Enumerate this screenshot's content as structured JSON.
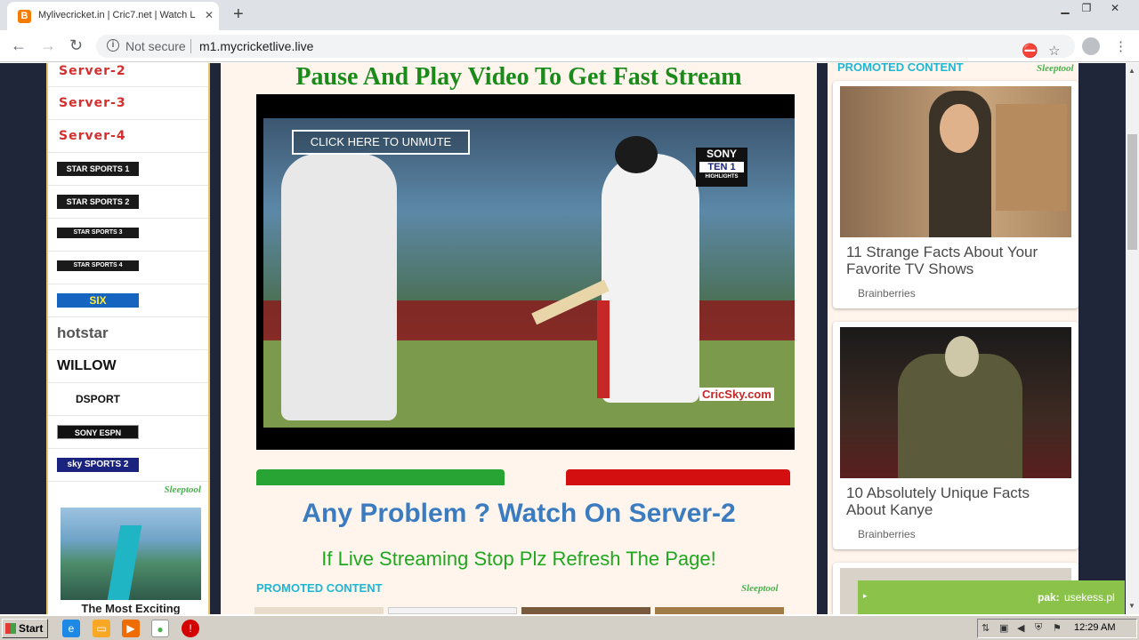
{
  "browser": {
    "tab_title": "Mylivecricket.in | Cric7.net | Watch L",
    "tab_favicon": "B",
    "security_label": "Not secure",
    "url": "m1.mycricketlive.live"
  },
  "left_sidebar": {
    "servers": [
      {
        "label": "Server-2"
      },
      {
        "label": "Server-3"
      },
      {
        "label": "Server-4"
      }
    ],
    "channels": [
      {
        "name": "STAR SPORTS 1",
        "bg": "#1a1a1a",
        "fg": "#fff"
      },
      {
        "name": "STAR SPORTS 2",
        "bg": "#1a1a1a",
        "fg": "#fff"
      },
      {
        "name": "STAR SPORTS 3",
        "bg": "#1a1a1a",
        "fg": "#fff"
      },
      {
        "name": "STAR SPORTS 4",
        "bg": "#1a1a1a",
        "fg": "#fff"
      },
      {
        "name": "SIX",
        "bg": "#1565c0",
        "fg": "#ffeb3b"
      },
      {
        "name": "hotstar",
        "bg": "#fff",
        "fg": "#333"
      },
      {
        "name": "WILLOW",
        "bg": "#fff",
        "fg": "#111"
      },
      {
        "name": "DSPORT",
        "bg": "#fff",
        "fg": "#111"
      },
      {
        "name": "SONY ESPN",
        "bg": "#111",
        "fg": "#fff"
      },
      {
        "name": "sky SPORTS 2",
        "bg": "#1a237e",
        "fg": "#fff"
      }
    ],
    "ad": {
      "brand": "Sleeptool",
      "title": "The Most Exciting"
    }
  },
  "main": {
    "title": "Pause And Play Video To Get Fast Stream",
    "unmute_label": "CLICK HERE TO UNMUTE",
    "channel_logo": {
      "line1": "SONY",
      "line2": "TEN 1",
      "line3": "HIGHLIGHTS"
    },
    "watermark": "CricSky.com",
    "problem_text": "Any Problem ? Watch On Server-2",
    "refresh_text": "If Live Streaming Stop Plz Refresh The Page!",
    "promoted_label": "PROMOTED CONTENT",
    "promoted_brand": "Sleeptool"
  },
  "right_sidebar": {
    "promoted_label": "PROMOTED CONTENT",
    "promoted_brand": "Sleeptool",
    "cards": [
      {
        "title": "11 Strange Facts About Your Favorite TV Shows",
        "source": "Brainberries"
      },
      {
        "title": "10 Absolutely Unique Facts About Kanye",
        "source": "Brainberries"
      }
    ],
    "ad_bar_label": "pak:",
    "ad_bar_value": "usekess.pl"
  },
  "taskbar": {
    "start_label": "Start",
    "clock": "12:29 AM"
  },
  "colors": {
    "server_red": "#d32f2f",
    "title_green": "#1a8a1a",
    "problem_blue": "#3b7bbf",
    "promoted_cyan": "#1fb6d4"
  }
}
